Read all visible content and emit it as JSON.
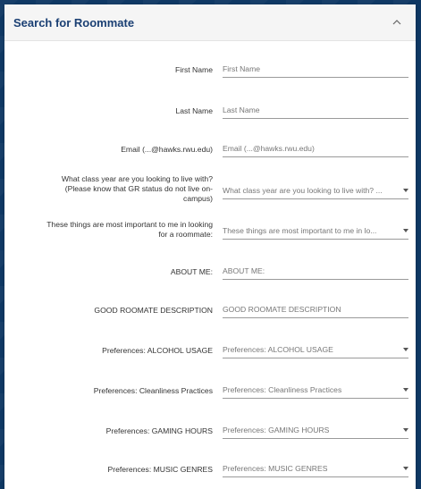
{
  "panel": {
    "title": "Search for Roommate"
  },
  "fields": {
    "first_name": {
      "label": "First Name",
      "placeholder": "First Name"
    },
    "last_name": {
      "label": "Last Name",
      "placeholder": "Last Name"
    },
    "email": {
      "label": "Email (...@hawks.rwu.edu)",
      "placeholder": "Email (...@hawks.rwu.edu)"
    },
    "class_year": {
      "label_line1": "What class year are you looking to live with?",
      "label_line2": "(Please know that GR status do not live on-",
      "label_line3": "campus)",
      "selected": "What class year are you looking to live with? ..."
    },
    "important": {
      "label_line1": "These things are most important to me in looking",
      "label_line2": "for a roommate:",
      "selected": "These things are most important to me in lo..."
    },
    "about_me": {
      "label": "ABOUT ME:",
      "placeholder": "ABOUT ME:"
    },
    "good_roommate": {
      "label": "GOOD ROOMATE DESCRIPTION",
      "placeholder": "GOOD ROOMATE DESCRIPTION"
    },
    "alcohol": {
      "label": "Preferences: ALCOHOL USAGE",
      "selected": "Preferences: ALCOHOL USAGE"
    },
    "cleanliness": {
      "label": "Preferences: Cleanliness Practices",
      "selected": "Preferences: Cleanliness Practices"
    },
    "gaming": {
      "label": "Preferences: GAMING HOURS",
      "selected": "Preferences: GAMING HOURS"
    },
    "music": {
      "label": "Preferences: MUSIC GENRES",
      "selected": "Preferences: MUSIC GENRES"
    }
  },
  "icons": {
    "collapse": "chevron-up-icon",
    "dropdown": "caret-down-icon"
  },
  "colors": {
    "background": "#0f3864",
    "title": "#1a3f73",
    "header_bg": "#f5f5f5"
  }
}
